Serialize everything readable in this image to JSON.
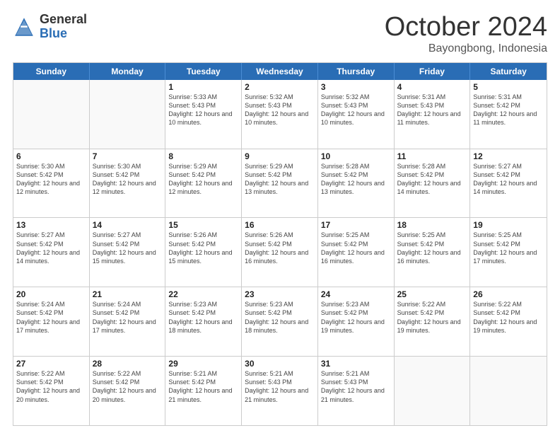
{
  "logo": {
    "general": "General",
    "blue": "Blue"
  },
  "title": {
    "month": "October 2024",
    "location": "Bayongbong, Indonesia"
  },
  "header_days": [
    "Sunday",
    "Monday",
    "Tuesday",
    "Wednesday",
    "Thursday",
    "Friday",
    "Saturday"
  ],
  "weeks": [
    [
      {
        "day": "",
        "info": ""
      },
      {
        "day": "",
        "info": ""
      },
      {
        "day": "1",
        "info": "Sunrise: 5:33 AM\nSunset: 5:43 PM\nDaylight: 12 hours and 10 minutes."
      },
      {
        "day": "2",
        "info": "Sunrise: 5:32 AM\nSunset: 5:43 PM\nDaylight: 12 hours and 10 minutes."
      },
      {
        "day": "3",
        "info": "Sunrise: 5:32 AM\nSunset: 5:43 PM\nDaylight: 12 hours and 10 minutes."
      },
      {
        "day": "4",
        "info": "Sunrise: 5:31 AM\nSunset: 5:43 PM\nDaylight: 12 hours and 11 minutes."
      },
      {
        "day": "5",
        "info": "Sunrise: 5:31 AM\nSunset: 5:42 PM\nDaylight: 12 hours and 11 minutes."
      }
    ],
    [
      {
        "day": "6",
        "info": "Sunrise: 5:30 AM\nSunset: 5:42 PM\nDaylight: 12 hours and 12 minutes."
      },
      {
        "day": "7",
        "info": "Sunrise: 5:30 AM\nSunset: 5:42 PM\nDaylight: 12 hours and 12 minutes."
      },
      {
        "day": "8",
        "info": "Sunrise: 5:29 AM\nSunset: 5:42 PM\nDaylight: 12 hours and 12 minutes."
      },
      {
        "day": "9",
        "info": "Sunrise: 5:29 AM\nSunset: 5:42 PM\nDaylight: 12 hours and 13 minutes."
      },
      {
        "day": "10",
        "info": "Sunrise: 5:28 AM\nSunset: 5:42 PM\nDaylight: 12 hours and 13 minutes."
      },
      {
        "day": "11",
        "info": "Sunrise: 5:28 AM\nSunset: 5:42 PM\nDaylight: 12 hours and 14 minutes."
      },
      {
        "day": "12",
        "info": "Sunrise: 5:27 AM\nSunset: 5:42 PM\nDaylight: 12 hours and 14 minutes."
      }
    ],
    [
      {
        "day": "13",
        "info": "Sunrise: 5:27 AM\nSunset: 5:42 PM\nDaylight: 12 hours and 14 minutes."
      },
      {
        "day": "14",
        "info": "Sunrise: 5:27 AM\nSunset: 5:42 PM\nDaylight: 12 hours and 15 minutes."
      },
      {
        "day": "15",
        "info": "Sunrise: 5:26 AM\nSunset: 5:42 PM\nDaylight: 12 hours and 15 minutes."
      },
      {
        "day": "16",
        "info": "Sunrise: 5:26 AM\nSunset: 5:42 PM\nDaylight: 12 hours and 16 minutes."
      },
      {
        "day": "17",
        "info": "Sunrise: 5:25 AM\nSunset: 5:42 PM\nDaylight: 12 hours and 16 minutes."
      },
      {
        "day": "18",
        "info": "Sunrise: 5:25 AM\nSunset: 5:42 PM\nDaylight: 12 hours and 16 minutes."
      },
      {
        "day": "19",
        "info": "Sunrise: 5:25 AM\nSunset: 5:42 PM\nDaylight: 12 hours and 17 minutes."
      }
    ],
    [
      {
        "day": "20",
        "info": "Sunrise: 5:24 AM\nSunset: 5:42 PM\nDaylight: 12 hours and 17 minutes."
      },
      {
        "day": "21",
        "info": "Sunrise: 5:24 AM\nSunset: 5:42 PM\nDaylight: 12 hours and 17 minutes."
      },
      {
        "day": "22",
        "info": "Sunrise: 5:23 AM\nSunset: 5:42 PM\nDaylight: 12 hours and 18 minutes."
      },
      {
        "day": "23",
        "info": "Sunrise: 5:23 AM\nSunset: 5:42 PM\nDaylight: 12 hours and 18 minutes."
      },
      {
        "day": "24",
        "info": "Sunrise: 5:23 AM\nSunset: 5:42 PM\nDaylight: 12 hours and 19 minutes."
      },
      {
        "day": "25",
        "info": "Sunrise: 5:22 AM\nSunset: 5:42 PM\nDaylight: 12 hours and 19 minutes."
      },
      {
        "day": "26",
        "info": "Sunrise: 5:22 AM\nSunset: 5:42 PM\nDaylight: 12 hours and 19 minutes."
      }
    ],
    [
      {
        "day": "27",
        "info": "Sunrise: 5:22 AM\nSunset: 5:42 PM\nDaylight: 12 hours and 20 minutes."
      },
      {
        "day": "28",
        "info": "Sunrise: 5:22 AM\nSunset: 5:42 PM\nDaylight: 12 hours and 20 minutes."
      },
      {
        "day": "29",
        "info": "Sunrise: 5:21 AM\nSunset: 5:42 PM\nDaylight: 12 hours and 21 minutes."
      },
      {
        "day": "30",
        "info": "Sunrise: 5:21 AM\nSunset: 5:43 PM\nDaylight: 12 hours and 21 minutes."
      },
      {
        "day": "31",
        "info": "Sunrise: 5:21 AM\nSunset: 5:43 PM\nDaylight: 12 hours and 21 minutes."
      },
      {
        "day": "",
        "info": ""
      },
      {
        "day": "",
        "info": ""
      }
    ]
  ]
}
